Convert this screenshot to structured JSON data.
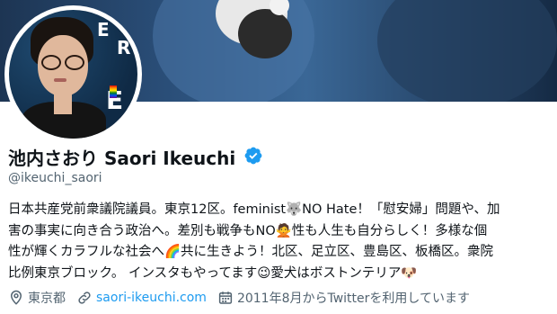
{
  "profile": {
    "display_name": "池内さおり Saori Ikeuchi",
    "handle": "@ikeuchi_saori",
    "verified": true,
    "bio_lines": [
      "日本共産党前衆議院議員。東京12区。feminist🐺NO Hate！「慰安婦」問題や、加",
      "害の事実に向き合う政治へ。差別も戦争もNO🙅性も人生も自分らしく！多様な個",
      "性が輝くカラフルな社会へ🌈共に生きよう！北区、足立区、豊島区、板橋区。衆院",
      "比例東京ブロック。 インスタもやってます😉愛犬はボストンテリア🐶"
    ],
    "location": "東京都",
    "website": "saori-ikeuchi.com",
    "joined": "2011年8月からTwitterを利用しています"
  },
  "avatar": {
    "letters": [
      "E",
      "R",
      "E",
      "U",
      "A"
    ]
  },
  "icons": {
    "verified": "verified-badge-icon",
    "location": "location-pin-icon",
    "link": "link-icon",
    "calendar": "calendar-icon"
  },
  "colors": {
    "accent": "#1d9bf0",
    "secondary_text": "#536471",
    "text": "#0f1419"
  }
}
